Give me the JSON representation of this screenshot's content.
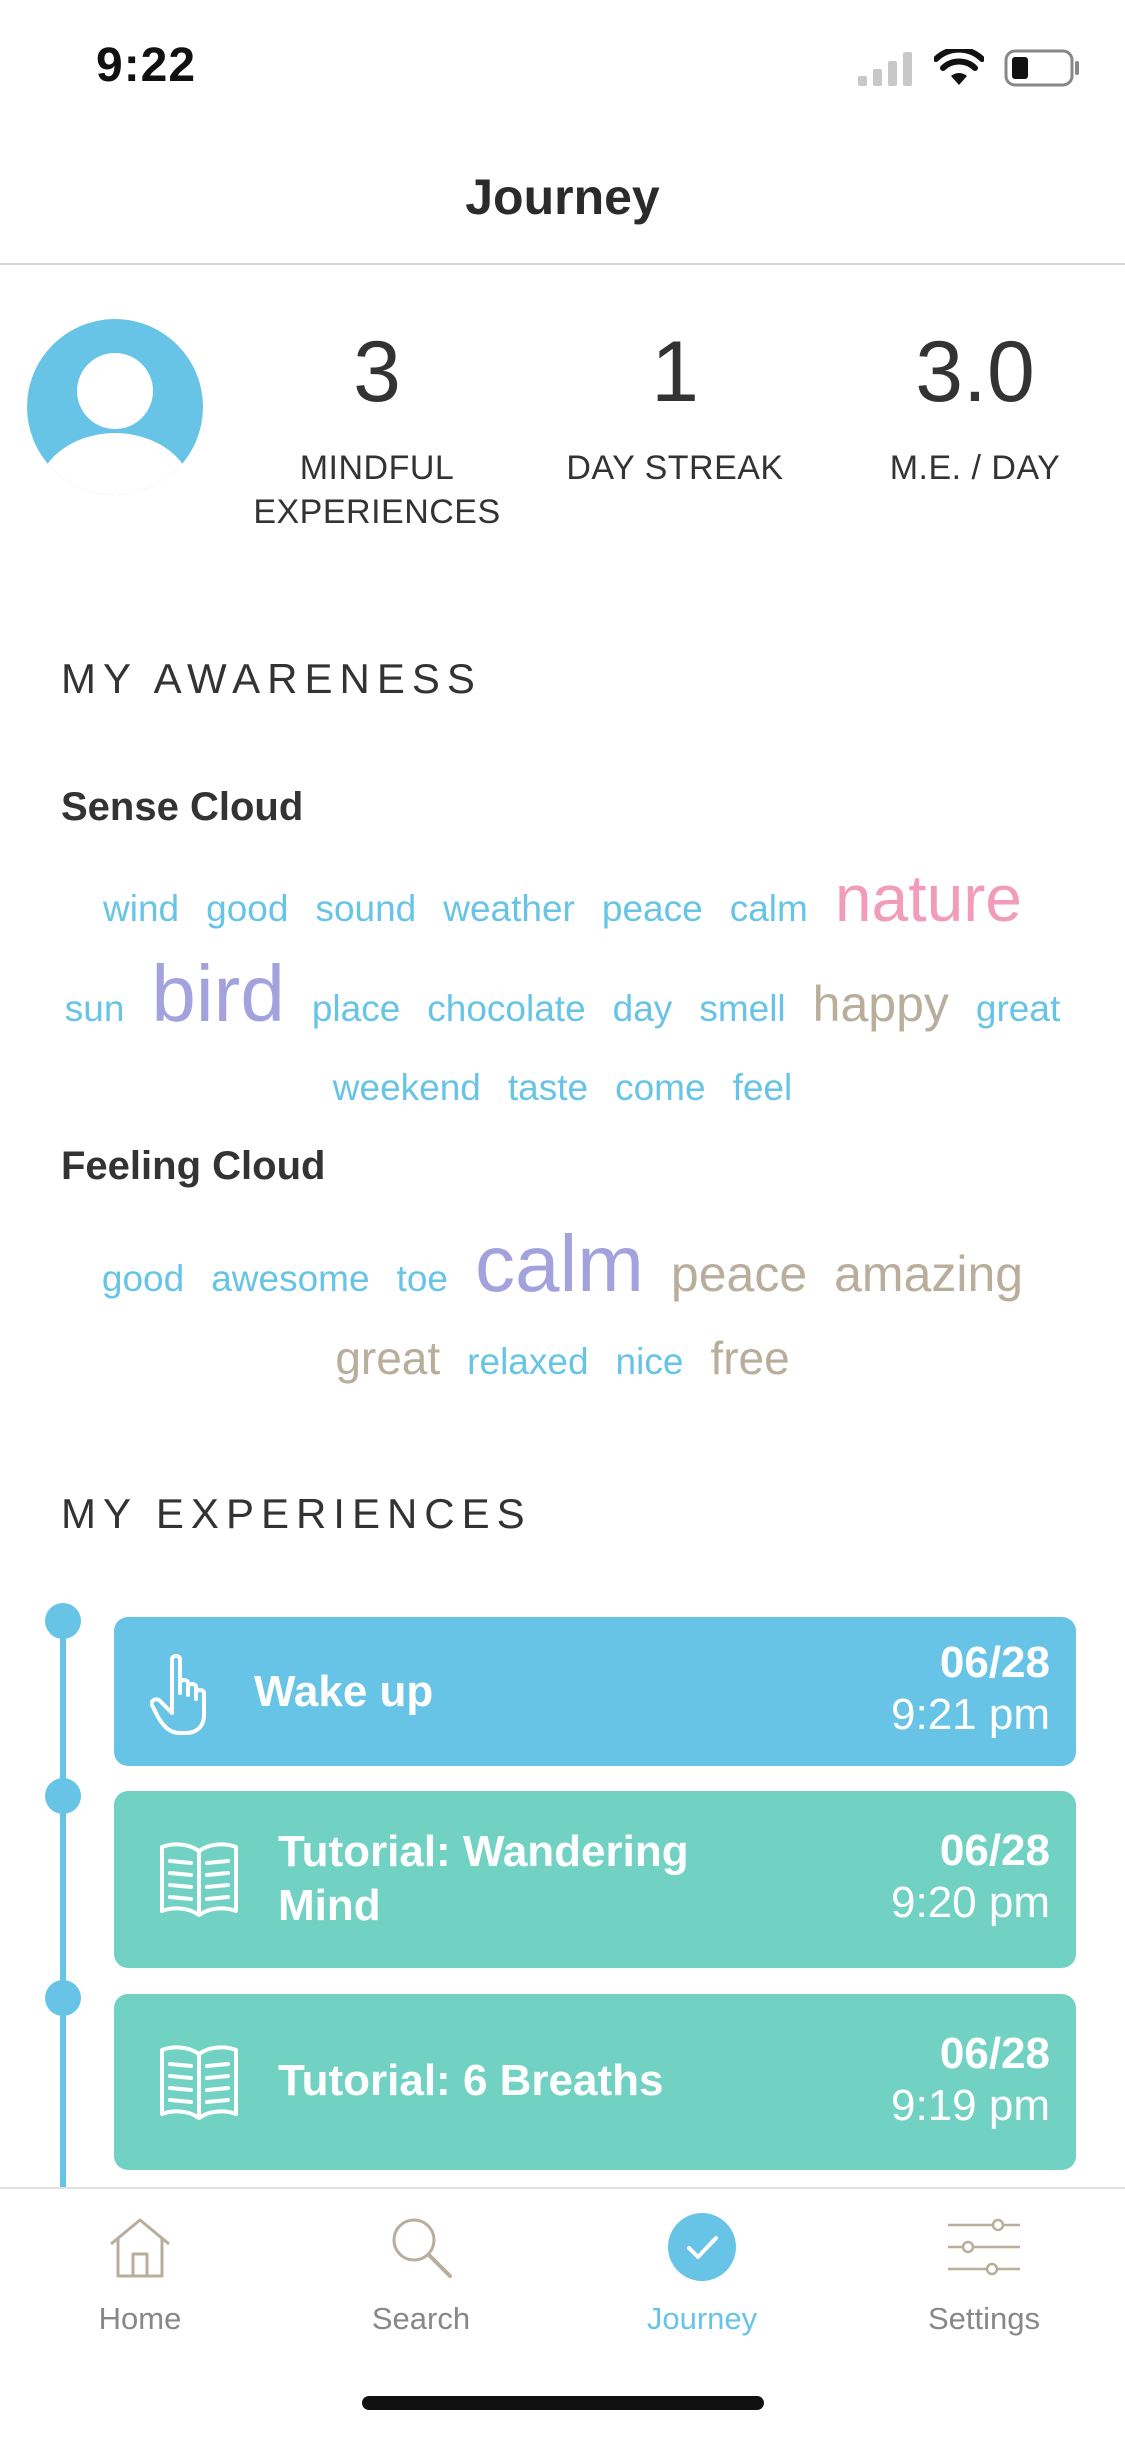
{
  "status_bar": {
    "time": "9:22"
  },
  "nav": {
    "title": "Journey"
  },
  "profile": {
    "stats": [
      {
        "value": "3",
        "label_line1": "MINDFUL",
        "label_line2": "EXPERIENCES"
      },
      {
        "value": "1",
        "label_line1": "DAY STREAK",
        "label_line2": ""
      },
      {
        "value": "3.0",
        "label_line1": "M.E. / DAY",
        "label_line2": ""
      }
    ]
  },
  "awareness": {
    "title": "MY AWARENESS",
    "sense_cloud": {
      "title": "Sense Cloud",
      "words": [
        "wind",
        "good",
        "sound",
        "weather",
        "peace",
        "calm",
        "nature",
        "sun",
        "bird",
        "place",
        "chocolate",
        "day",
        "smell",
        "happy",
        "great",
        "weekend",
        "taste",
        "come",
        "feel"
      ]
    },
    "feeling_cloud": {
      "title": "Feeling Cloud",
      "words": [
        "good",
        "awesome",
        "toe",
        "calm",
        "peace",
        "amazing",
        "great",
        "relaxed",
        "nice",
        "free"
      ]
    }
  },
  "experiences": {
    "title": "MY EXPERIENCES",
    "items": [
      {
        "title": "Wake up",
        "date": "06/28",
        "time": "9:21 pm",
        "icon": "hand-pointer-icon",
        "color": "#67c4e6"
      },
      {
        "title": "Tutorial: Wandering Mind",
        "date": "06/28",
        "time": "9:20 pm",
        "icon": "book-icon",
        "color": "#71d2c4"
      },
      {
        "title": "Tutorial: 6 Breaths",
        "date": "06/28",
        "time": "9:19 pm",
        "icon": "book-icon",
        "color": "#71d2c4"
      }
    ]
  },
  "tabbar": {
    "tabs": [
      {
        "label": "Home",
        "icon": "home-icon"
      },
      {
        "label": "Search",
        "icon": "search-icon"
      },
      {
        "label": "Journey",
        "icon": "check-circle-icon",
        "active": true
      },
      {
        "label": "Settings",
        "icon": "sliders-icon"
      }
    ]
  },
  "colors": {
    "accent": "#67c4e6",
    "teal": "#71d2c4",
    "pink": "#f29bbb",
    "purple": "#a3a2dd",
    "tan": "#b9ad9b"
  }
}
